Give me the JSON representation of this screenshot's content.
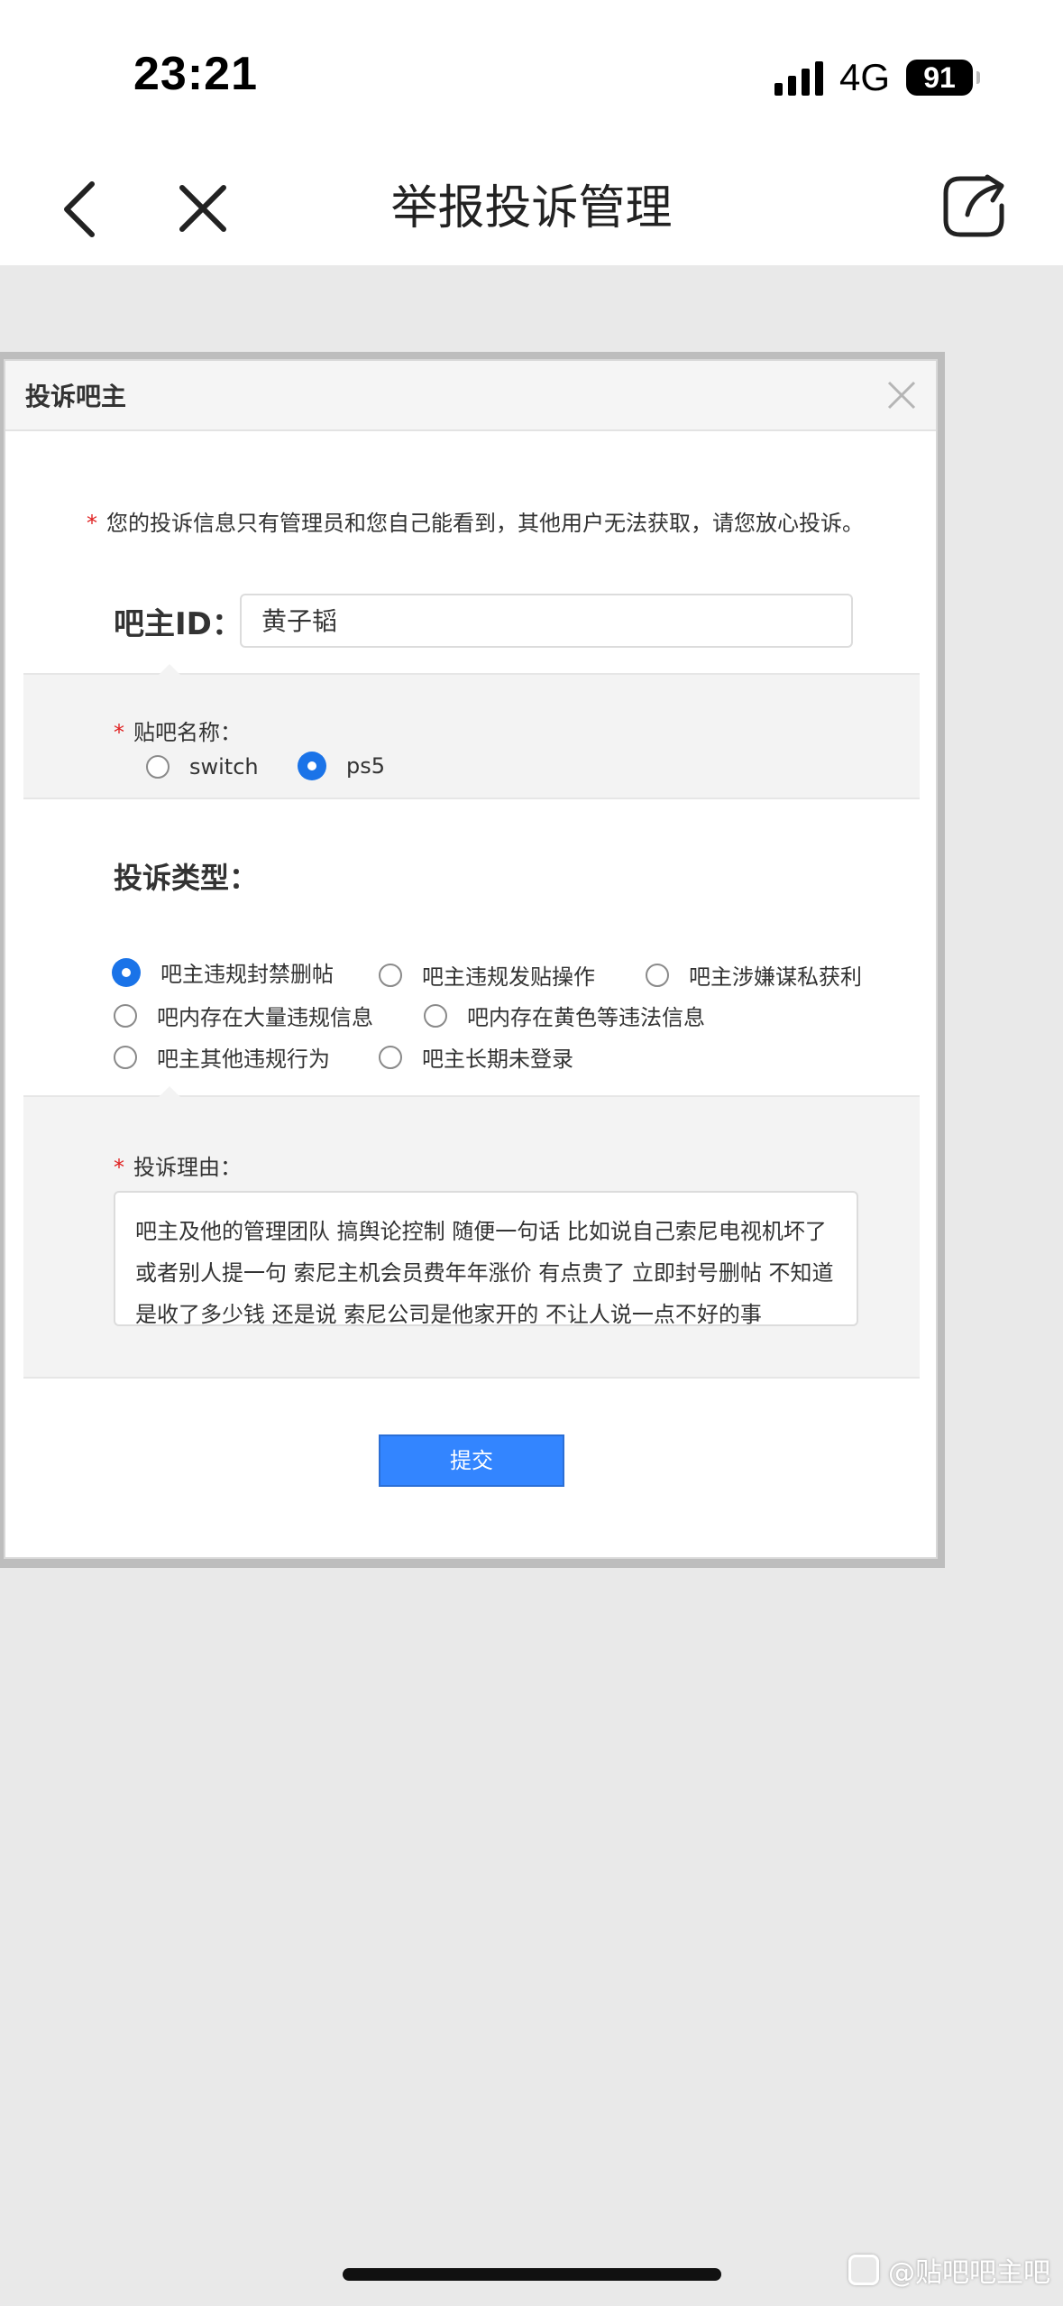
{
  "status_bar": {
    "time": "23:21",
    "network": "4G",
    "battery": "91"
  },
  "nav": {
    "title": "举报投诉管理",
    "icons": [
      "back-icon",
      "close-icon",
      "share-icon"
    ]
  },
  "dialog": {
    "title": "投诉吧主",
    "notice": "您的投诉信息只有管理员和您自己能看到，其他用户无法获取，请您放心投诉。",
    "required_mark": "*",
    "id_label": "吧主ID：",
    "id_value": "黄子韬",
    "forum_label": "贴吧名称：",
    "forum_options": [
      {
        "label": "switch",
        "selected": false
      },
      {
        "label": "ps5",
        "selected": true
      }
    ],
    "type_label": "投诉类型：",
    "type_options": [
      {
        "label": "吧主违规封禁删帖",
        "selected": true
      },
      {
        "label": "吧主违规发贴操作",
        "selected": false
      },
      {
        "label": "吧主涉嫌谋私获利",
        "selected": false
      },
      {
        "label": "吧内存在大量违规信息",
        "selected": false
      },
      {
        "label": "吧内存在黄色等违法信息",
        "selected": false
      },
      {
        "label": "吧主其他违规行为",
        "selected": false
      },
      {
        "label": "吧主长期未登录",
        "selected": false
      }
    ],
    "reason_label": "投诉理由：",
    "reason_text": "吧主及他的管理团队 搞舆论控制 随便一句话 比如说自己索尼电视机坏了 或者别人提一句 索尼主机会员费年年涨价 有点贵了 立即封号删帖 不知道是收了多少钱 还是说 索尼公司是他家开的 不让人说一点不好的事",
    "submit_label": "提交"
  },
  "watermark": "@贴吧吧主吧",
  "colors": {
    "accent": "#1a73e8",
    "button": "#3385ff",
    "required": "#e02020"
  }
}
